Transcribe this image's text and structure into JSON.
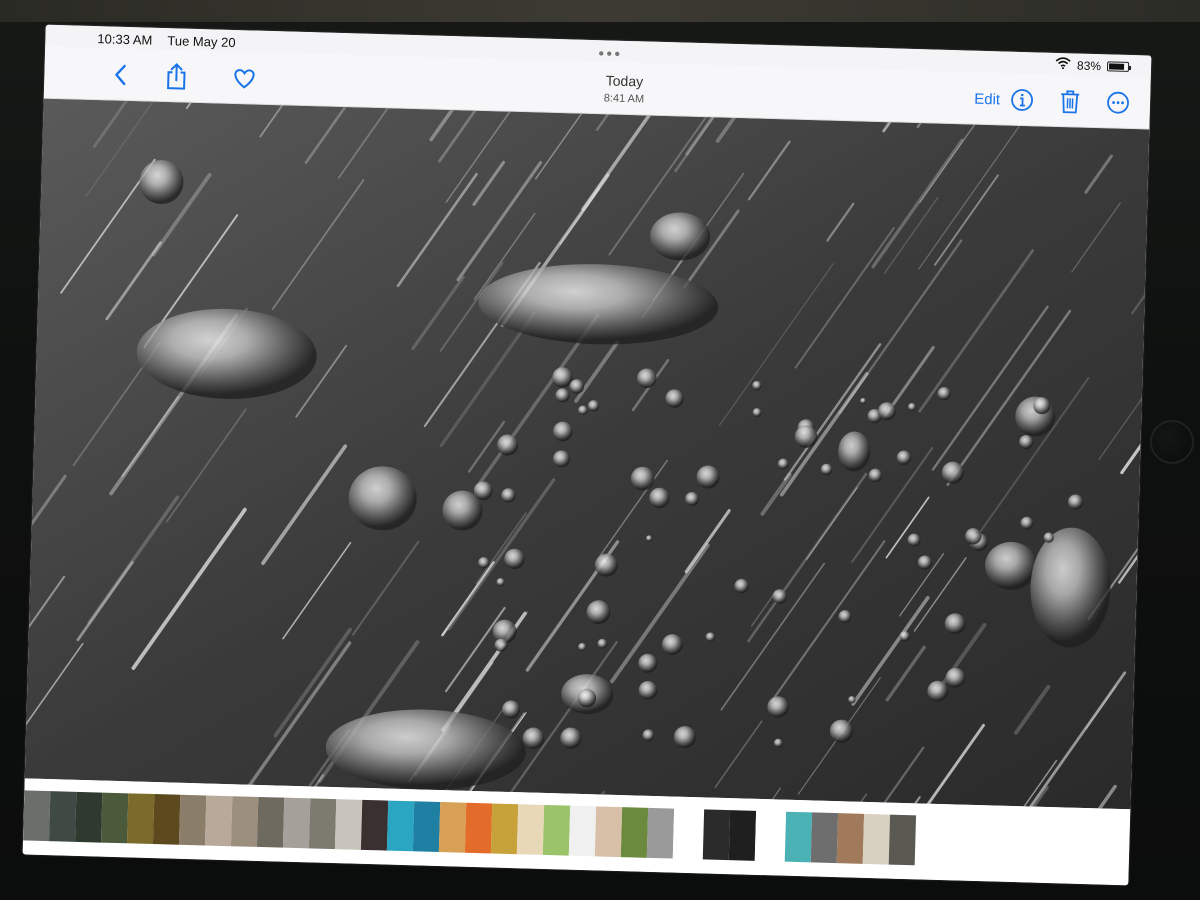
{
  "status_bar": {
    "time": "10:33 AM",
    "date": "Tue May 20",
    "battery_percent": "83%",
    "battery_level": 0.83
  },
  "nav": {
    "title": "Today",
    "subtitle": "8:41 AM",
    "edit_label": "Edit"
  },
  "icons": {
    "back": "chevron-left-icon",
    "share": "share-icon",
    "favorite": "heart-icon",
    "info": "info-icon",
    "delete": "trash-icon",
    "more": "ellipsis-icon",
    "wifi": "wifi-icon",
    "battery": "battery-icon"
  },
  "colors": {
    "accent": "#1a73e8"
  },
  "thumbnails": [
    "#6b6f6a",
    "#3f4a44",
    "#2e3a2f",
    "#4a5a3a",
    "#7a6b2a",
    "#5c4a1e",
    "#8a7d6a",
    "#b8a99a",
    "#9c8f7e",
    "#6e6a60",
    "#a5a19a",
    "#7d7a70",
    "#c8c4bc",
    "#3a3030",
    "#2aa6c2",
    "#1e7fa3",
    "#d7a055",
    "#e46c2a",
    "#c7a23a",
    "#e8d8b8",
    "#9ac36a",
    "#f0f0f0",
    "#d8c0a8",
    "#6b8a3e",
    "#9a9a9a",
    "gap",
    "#2b2b2b",
    "#1f1f1f",
    "gap",
    "#4ab2b5",
    "#6e6e6e",
    "#a07a5a",
    "#d8d0c0",
    "#5a5a52"
  ]
}
